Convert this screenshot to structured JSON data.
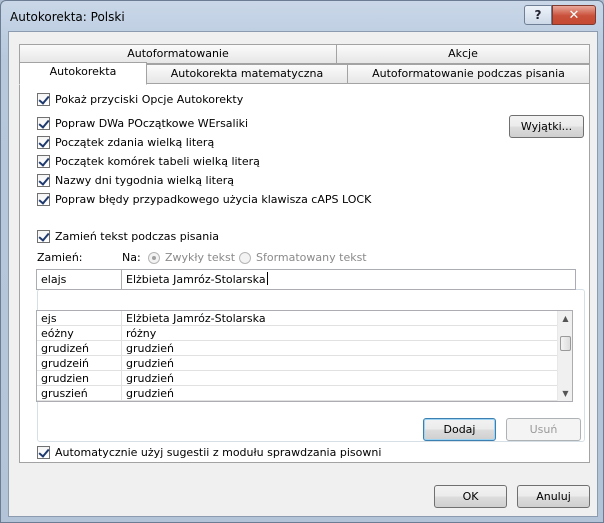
{
  "window": {
    "title": "Autokorekta: Polski",
    "help": "?",
    "close": "✕"
  },
  "tabs": {
    "row_back": [
      "Autoformatowanie",
      "Akcje"
    ],
    "row_front": [
      "Autokorekta",
      "Autokorekta matematyczna",
      "Autoformatowanie podczas pisania"
    ]
  },
  "options": {
    "show_buttons": "Pokaż przyciski Opcje Autokorekty",
    "fix_two_caps": "Popraw DWa POczątkowe WErsaliki",
    "sentence_cap": "Początek zdania wielką literą",
    "table_cap": "Początek komórek tabeli wielką literą",
    "day_names": "Nazwy dni tygodnia wielką literą",
    "caps_lock": "Popraw błędy przypadkowego użycia klawisza cAPS LOCK",
    "exceptions_button": "Wyjątki..."
  },
  "replace": {
    "enable": "Zamień tekst podczas pisania",
    "col_replace": "Zamień:",
    "col_with": "Na:",
    "radio_plain": "Zwykły tekst",
    "radio_formatted": "Sformatowany tekst",
    "replace_value": "elajs",
    "with_value": "Elżbieta Jamróz-Stolarska",
    "rows": [
      {
        "from": "ejs",
        "to": "Elżbieta Jamróz-Stolarska"
      },
      {
        "from": "eóżny",
        "to": "różny"
      },
      {
        "from": "grudizeń",
        "to": "grudzień"
      },
      {
        "from": "grudzeiń",
        "to": "grudzień"
      },
      {
        "from": "grudzien",
        "to": "grudzień"
      },
      {
        "from": "gruszień",
        "to": "grudzień"
      }
    ],
    "add_button": "Dodaj",
    "delete_button": "Usuń"
  },
  "spelling": {
    "auto_suggest": "Automatycznie użyj sugestii z modułu sprawdzania pisowni"
  },
  "footer": {
    "ok": "OK",
    "cancel": "Anuluj"
  }
}
